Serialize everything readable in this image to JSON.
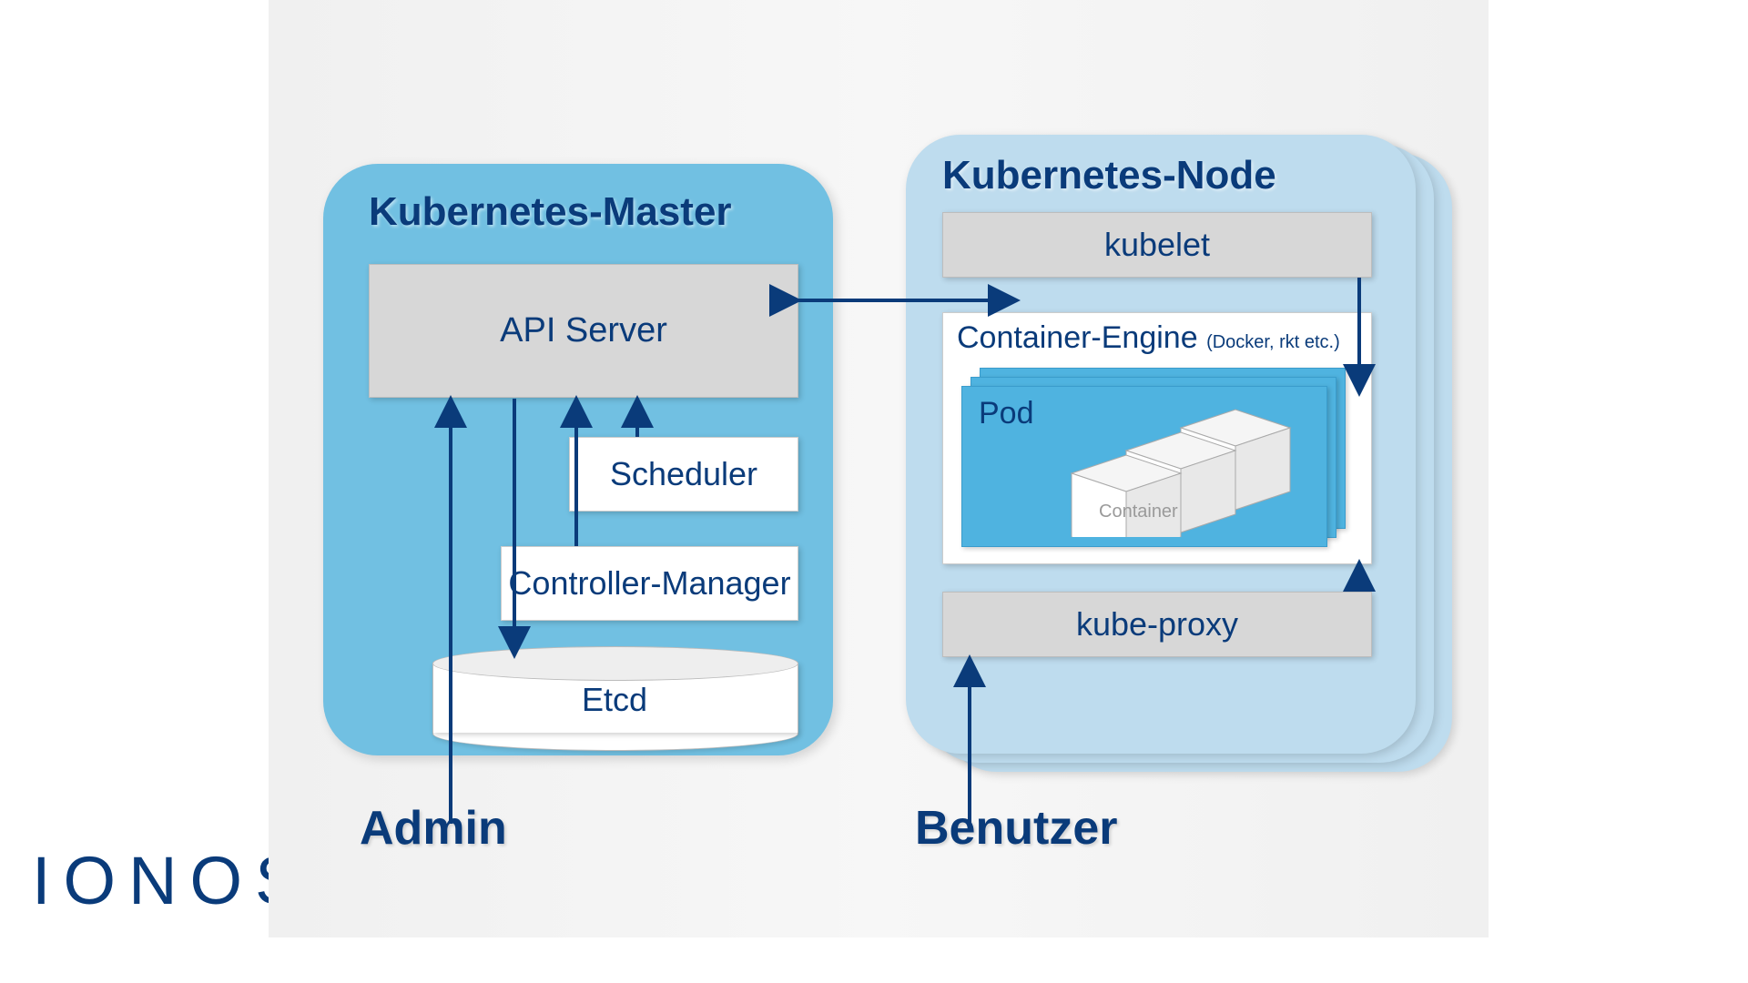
{
  "brand": "IONOS",
  "master": {
    "title": "Kubernetes-Master",
    "api": "API Server",
    "scheduler": "Scheduler",
    "controller": "Controller-Manager",
    "etcd": "Etcd"
  },
  "node": {
    "title": "Kubernetes-Node",
    "kubelet": "kubelet",
    "engine": "Container-Engine",
    "engine_sub": "(Docker, rkt etc.)",
    "pod": "Pod",
    "container": "Container",
    "kubeproxy": "kube-proxy"
  },
  "actors": {
    "admin": "Admin",
    "user": "Benutzer"
  },
  "colors": {
    "primary_text": "#0a3b7a",
    "master_bg": "#71c0e2",
    "node_bg": "#bedcee",
    "pod_bg": "#4fb3e0",
    "box_gray": "#d7d7d7"
  }
}
